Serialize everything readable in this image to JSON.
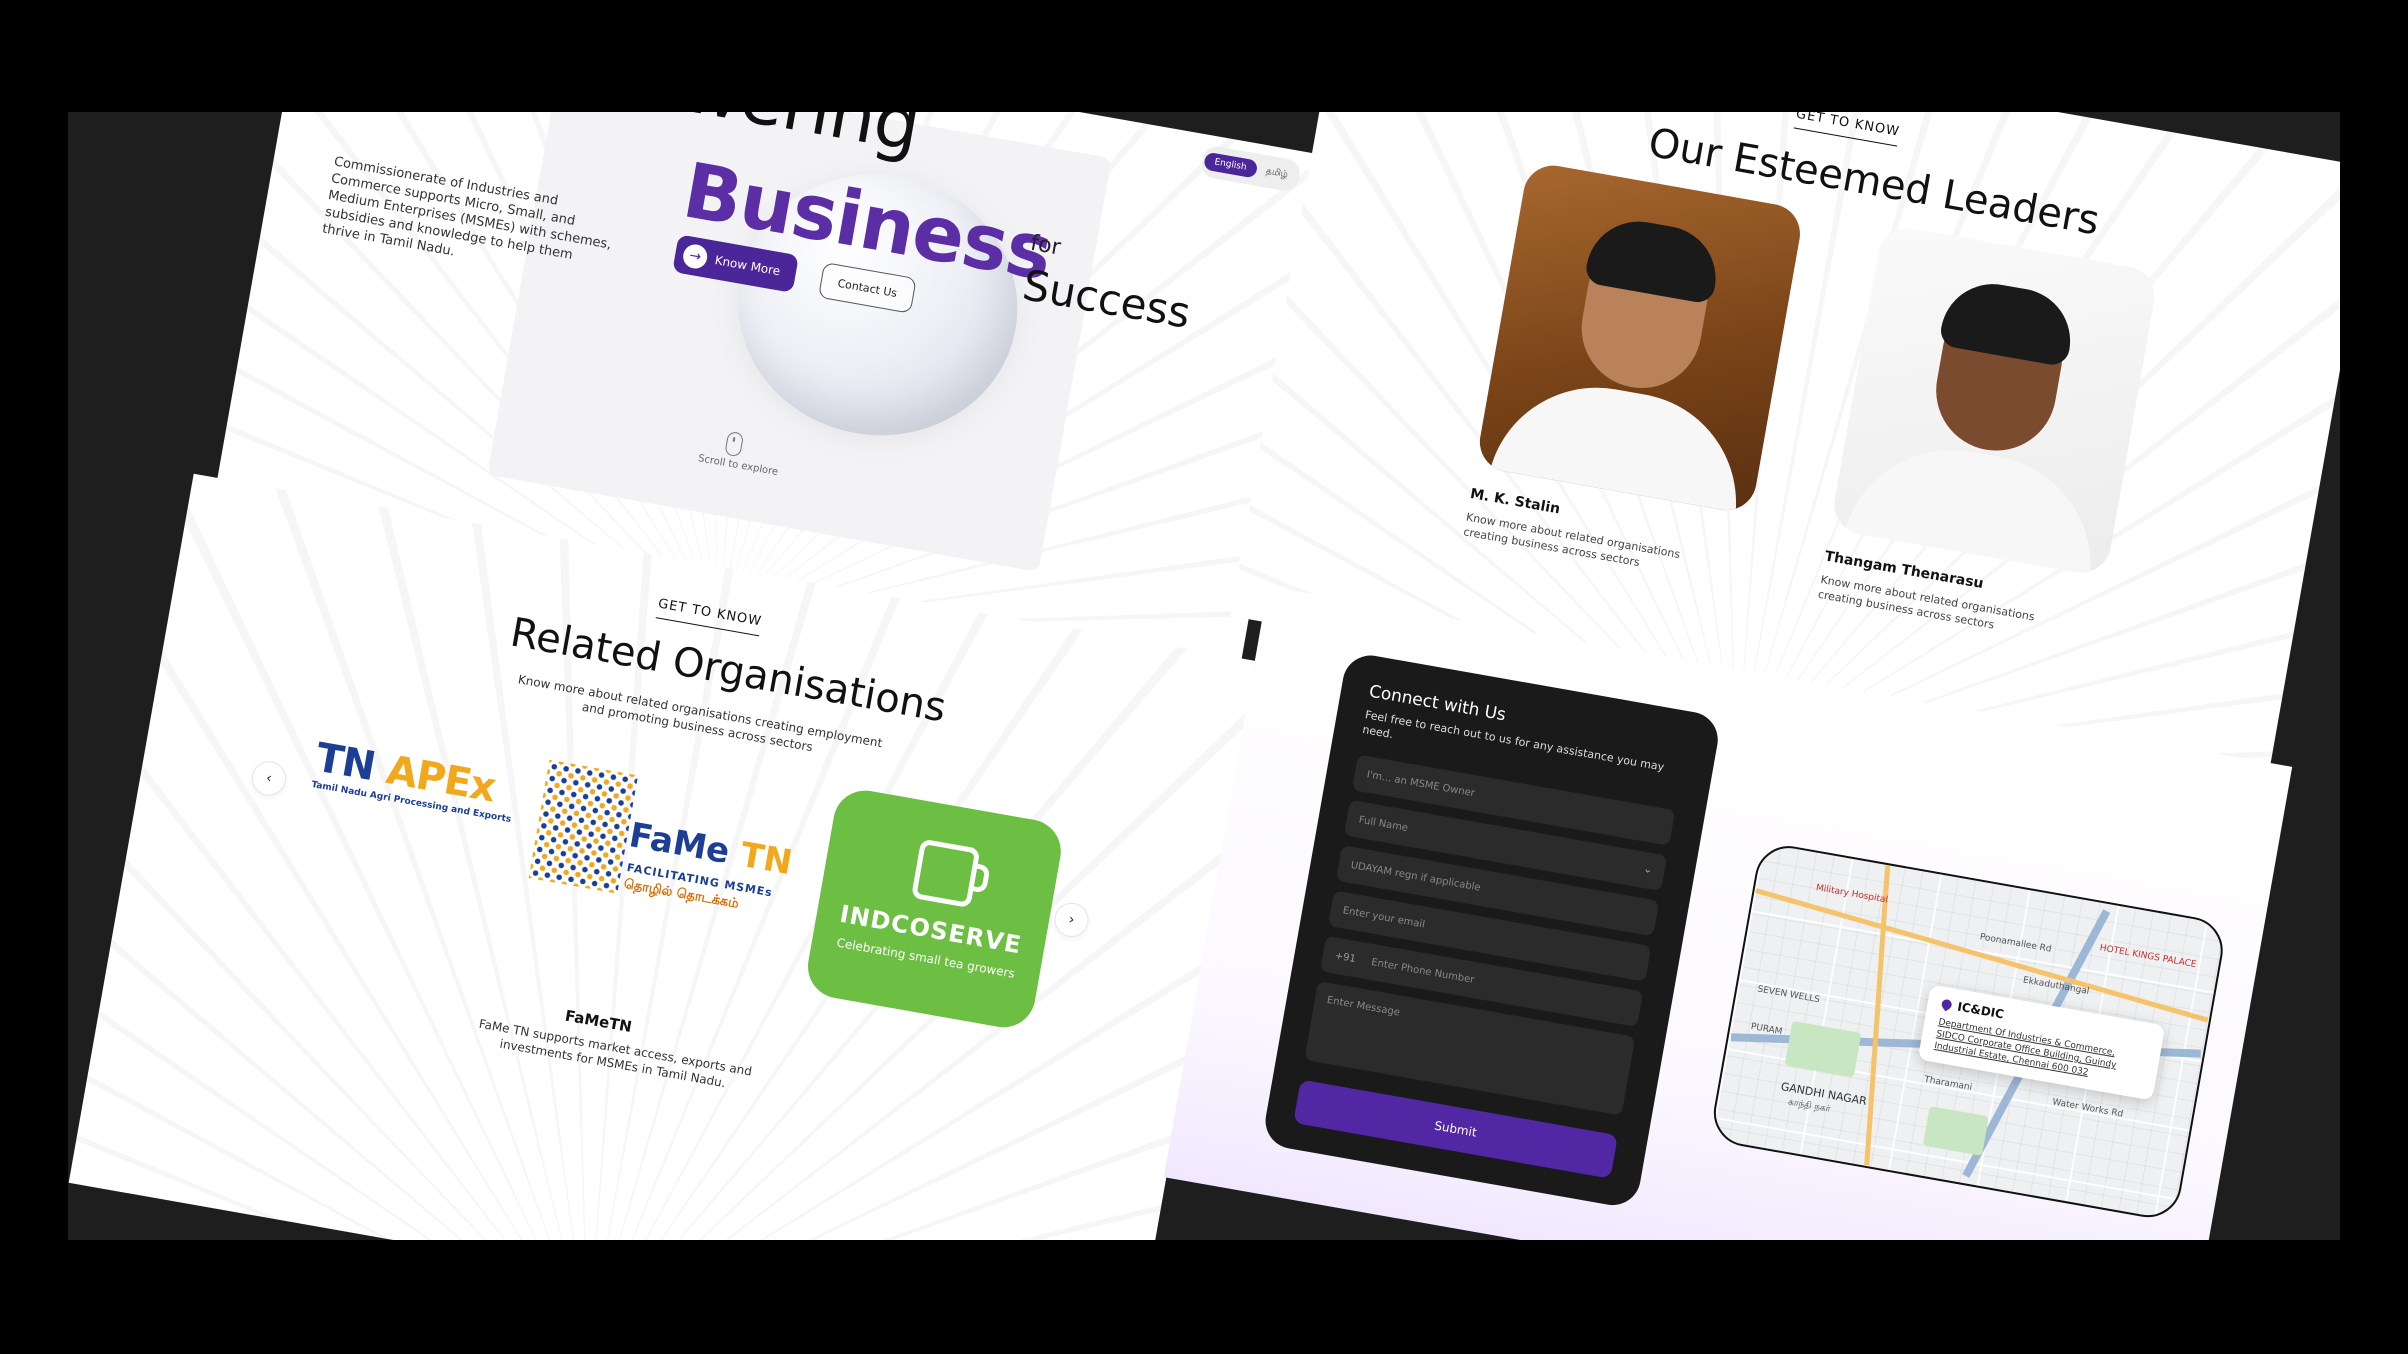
{
  "hero": {
    "line1": "Empowering",
    "line2": "Business",
    "line3_small": "for",
    "line3": "Success",
    "description": "Commissionerate of Industries and Commerce supports Micro, Small, and Medium Enterprises (MSMEs) with schemes, subsidies and knowledge to help them thrive in Tamil Nadu.",
    "know_more_label": "Know More",
    "contact_label": "Contact Us",
    "lang_en": "English",
    "lang_ta": "தமிழ்",
    "scroll_hint": "Scroll to explore"
  },
  "leaders": {
    "eyebrow": "GET TO KNOW",
    "title": "Our Esteemed Leaders",
    "people": [
      {
        "name": "M. K. Stalin",
        "subtitle": "Know more about related organisations creating business across sectors"
      },
      {
        "name": "Thangam Thenarasu",
        "subtitle": "Know more about related organisations creating business across sectors"
      }
    ]
  },
  "organisations": {
    "eyebrow": "GET TO KNOW",
    "title": "Related Organisations",
    "subtitle": "Know more about related organisations creating employment and promoting business across sectors",
    "prev_icon": "‹",
    "next_icon": "›",
    "logos": {
      "tnapex_a": "TN",
      "tnapex_b": "APEx",
      "tnapex_tag": "Tamil Nadu Agri Processing and Exports",
      "fame_a": "FaMe",
      "fame_b": "TN",
      "fame_tag": "FACILITATING MSMEs",
      "fame_tamil": "தொழில் தொடக்கம்",
      "indco_name": "INDCOSERVE",
      "indco_tag": "Celebrating small tea growers"
    },
    "selected_name": "FaMeTN",
    "selected_desc": "FaMe TN supports market access, exports and investments for MSMEs in Tamil Nadu."
  },
  "contact": {
    "title": "Connect with Us",
    "subtitle": "Feel free to reach out to us for any assistance you may need.",
    "fields": {
      "role": "I'm... an MSME Owner",
      "name": "Full Name",
      "udyam": "UDAYAM regn if applicable",
      "email": "Enter your email",
      "phone_cc": "+91",
      "phone": "Enter Phone Number",
      "message": "Enter Message"
    },
    "submit_label": "Submit",
    "map": {
      "popup_title": "IC&DIC",
      "popup_address": "Department Of Industries & Commerce, SIDCO Corporate Office Building, Guindy Industrial Estate, Chennai 600 032",
      "labels": {
        "hospital": "Military Hospital",
        "palace": "HOTEL KINGS PALACE",
        "poonamalle": "Poonamallee Rd",
        "ekkaduthangal": "Ekkaduthangal",
        "gandhi": "GANDHI NAGAR",
        "gandhi_ta": "காந்தி நகர்",
        "seven_wells": "SEVEN WELLS",
        "puram": "PURAM",
        "tharamani": "Tharamani",
        "water_works": "Water Works Rd"
      }
    }
  }
}
